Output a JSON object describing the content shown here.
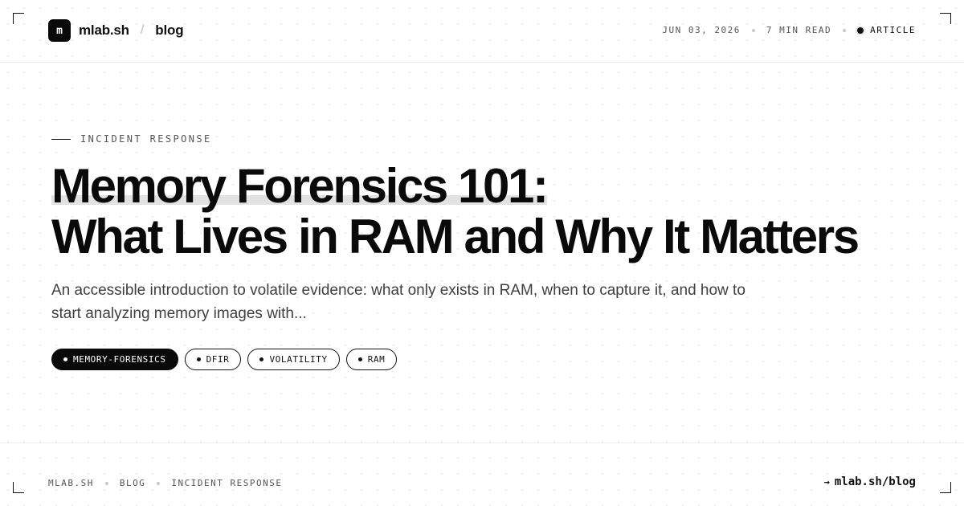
{
  "header": {
    "logo_letter": "m",
    "site_name": "mlab.sh",
    "separator": "/",
    "section": "blog",
    "meta": {
      "date": "JUN 03, 2026",
      "read_time": "7 MIN READ",
      "type": "ARTICLE"
    }
  },
  "article": {
    "kicker": "INCIDENT RESPONSE",
    "title_line_1": "Memory Forensics 101:",
    "title_line_2": "What Lives in RAM and Why It Matters",
    "lede": "An accessible introduction to volatile evidence: what only exists in RAM, when to capture it, and how to start analyzing memory images with...",
    "tags": [
      "MEMORY-FORENSICS",
      "DFIR",
      "VOLATILITY",
      "RAM"
    ]
  },
  "footer": {
    "breadcrumbs": [
      "MLAB.SH",
      "BLOG",
      "INCIDENT RESPONSE"
    ],
    "arrow": "→",
    "url": "mlab.sh/blog"
  }
}
